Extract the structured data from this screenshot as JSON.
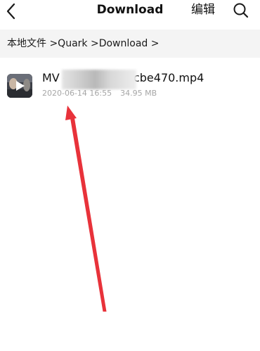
{
  "header": {
    "title": "Download",
    "edit_label": "编辑",
    "back_icon": "chevron-left-icon",
    "search_icon": "search-icon"
  },
  "breadcrumb": {
    "items": [
      "本地文件",
      ">Quark",
      ">Download",
      ">"
    ]
  },
  "files": [
    {
      "name_prefix": "MV -",
      "name_suffix": "09cbe470.mp4",
      "date": "2020-06-14 16:55",
      "size": "34.95 MB",
      "thumbnail_icon": "video-thumbnail-icon"
    }
  ],
  "colors": {
    "annotation_arrow": "#e8323a",
    "meta_text": "#a6a6a6",
    "breadcrumb_bg": "#f4f4f4"
  }
}
